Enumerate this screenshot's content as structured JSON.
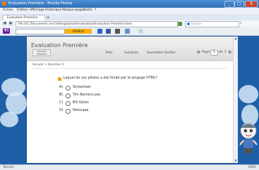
{
  "window": {
    "title": "Evaluation Première - Mozilla Firefox",
    "min": "_",
    "max": "□",
    "close": "X"
  },
  "menu": [
    "Fichier",
    "Édition",
    "Affichage",
    "Historique",
    "Marque-pages",
    "Outils",
    "?"
  ],
  "tab": {
    "label": "Évaluation Première"
  },
  "nav": {
    "back": "◀",
    "forward": "▶",
    "url": "file:///C:/Documents and Settings/projet/evaluation/Evaluation Première.html",
    "search_placeholder": "Google"
  },
  "yahoo": {
    "logo": "Y!",
    "search_button": "SEARCH"
  },
  "page": {
    "title": "Evaluation Première",
    "badge": "Aucune réponse",
    "nav": [
      "Préc.",
      "Suivante",
      "Soumettre",
      "Quitter"
    ],
    "pager_label": "Page",
    "page_current": "1",
    "page_sep": "de",
    "page_total": "1",
    "breadcrumb": "Accueil > Question 1",
    "question": "Lequel de ces pilotes a été fondé par le langage HTML?",
    "options": [
      {
        "letter": "A)",
        "label": "Stylesheet"
      },
      {
        "letter": "B)",
        "label": "Tim Berners-Lee"
      },
      {
        "letter": "C)",
        "label": "Bill Gates"
      },
      {
        "letter": "D)",
        "label": "Netscape"
      }
    ]
  },
  "status": {
    "text": "Terminé",
    "zoom": "100%"
  },
  "colors": {
    "accent": "#2f6fb3",
    "question_icon": "#f0a020",
    "yahoo": "#6b1fa1"
  }
}
